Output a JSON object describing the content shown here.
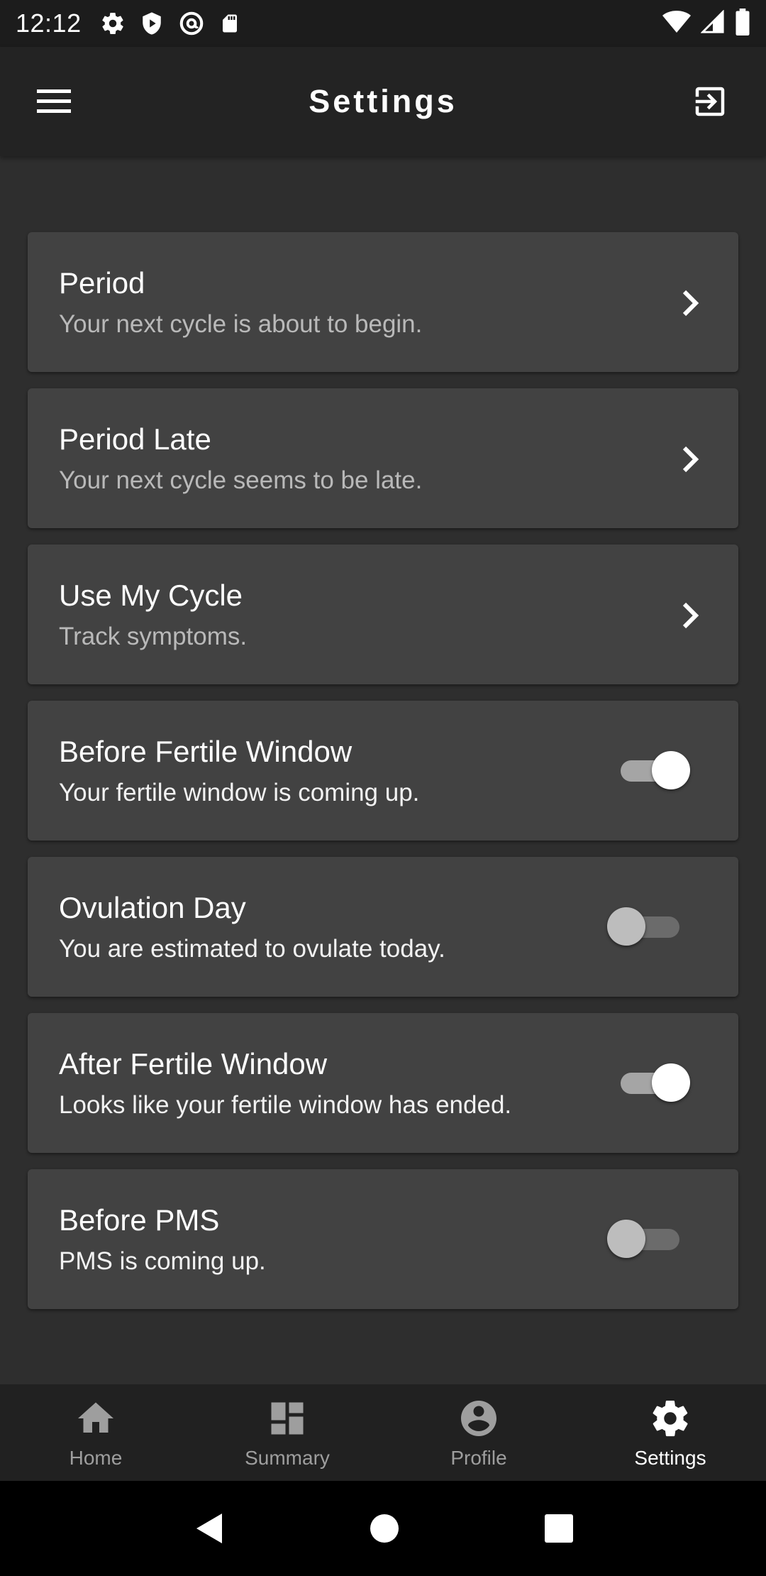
{
  "status_bar": {
    "time": "12:12",
    "left_icons": [
      "settings-gear-icon",
      "shield-icon",
      "at-sign-icon",
      "sd-card-icon"
    ],
    "right_icons": [
      "wifi-icon",
      "cell-signal-icon",
      "battery-icon"
    ]
  },
  "app_bar": {
    "title": "Settings",
    "menu_icon": "hamburger-menu-icon",
    "action_icon": "logout-icon"
  },
  "settings": [
    {
      "title": "Period",
      "subtitle": "Your next cycle is about to begin.",
      "control": "chevron"
    },
    {
      "title": "Period Late",
      "subtitle": "Your next cycle seems to be late.",
      "control": "chevron"
    },
    {
      "title": "Use My Cycle",
      "subtitle": "Track symptoms.",
      "control": "chevron"
    },
    {
      "title": "Before Fertile Window",
      "subtitle": "Your fertile window is coming up.",
      "control": "toggle",
      "enabled": true
    },
    {
      "title": "Ovulation Day",
      "subtitle": "You are estimated to ovulate today.",
      "control": "toggle",
      "enabled": false
    },
    {
      "title": "After Fertile Window",
      "subtitle": "Looks like your fertile window has ended.",
      "control": "toggle",
      "enabled": true
    },
    {
      "title": "Before PMS",
      "subtitle": "PMS is coming up.",
      "control": "toggle",
      "enabled": false
    }
  ],
  "bottom_nav": {
    "items": [
      {
        "label": "Home",
        "icon": "home-icon",
        "active": false
      },
      {
        "label": "Summary",
        "icon": "dashboard-icon",
        "active": false
      },
      {
        "label": "Profile",
        "icon": "account-circle-icon",
        "active": false
      },
      {
        "label": "Settings",
        "icon": "settings-icon",
        "active": true
      }
    ]
  },
  "system_nav": {
    "icons": [
      "back-icon",
      "home-circle-icon",
      "recents-icon"
    ]
  },
  "colors": {
    "background": "#2e2e2e",
    "app_bar": "#232323",
    "card": "#424242",
    "nav_bar": "#212121",
    "toggle_on_thumb": "#ffffff",
    "toggle_off_thumb": "#bdbdbd"
  }
}
